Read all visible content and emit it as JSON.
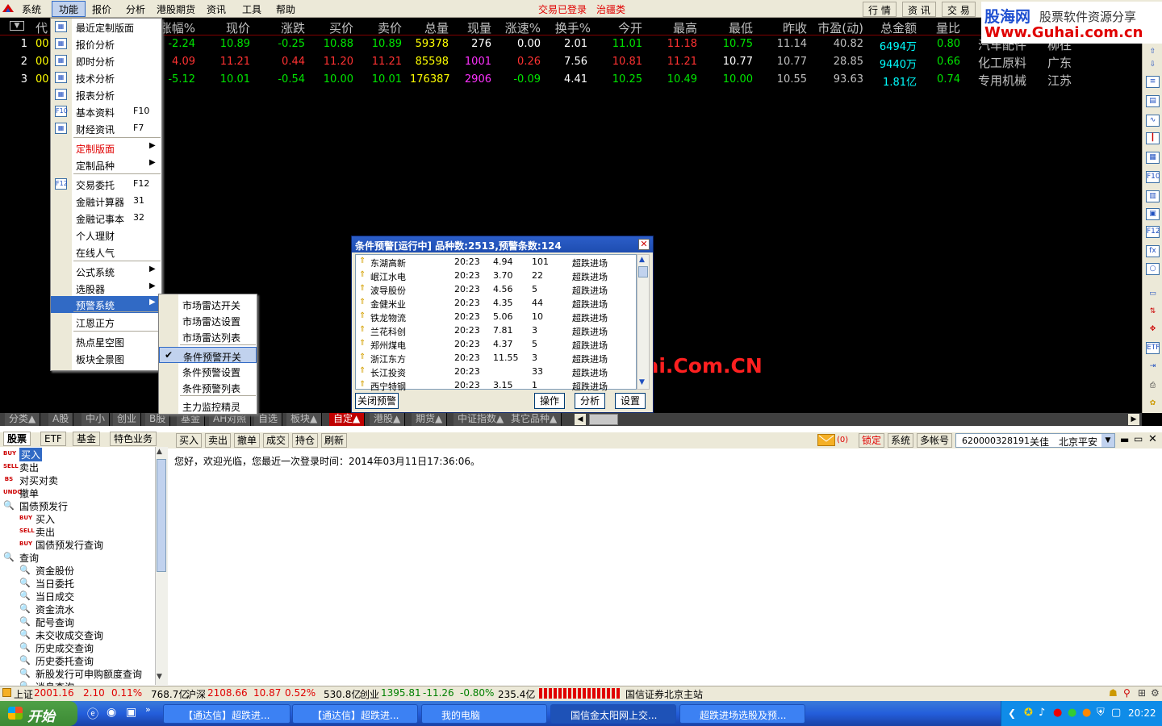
{
  "menubar": {
    "items": [
      "系统",
      "功能",
      "报价",
      "分析",
      "港股期货",
      "资讯",
      "工具",
      "帮助"
    ],
    "status1": "交易已登录",
    "status2": "治疆类",
    "tabs": [
      "行 情",
      "资 讯",
      "交 易"
    ]
  },
  "banner": {
    "brand": "股海网",
    "tagline": "股票软件资源分享",
    "url": "Www.Guhai.com.cn"
  },
  "grid": {
    "headers": [
      "代",
      "涨幅%",
      "现价",
      "涨跌",
      "买价",
      "卖价",
      "总量",
      "现量",
      "涨速%",
      "换手%",
      "今开",
      "最高",
      "最低",
      "昨收",
      "市盈(动)",
      "总金额",
      "量比"
    ],
    "rows": [
      {
        "idx": "1",
        "code": "00",
        "chg_pct": "-2.24",
        "price": "10.89",
        "chg": "-0.25",
        "bid": "10.88",
        "ask": "10.89",
        "vol": "59378",
        "cur_vol": "276",
        "speed": "0.00",
        "turnover": "2.01",
        "open": "11.01",
        "high": "11.18",
        "low": "10.75",
        "prev": "11.14",
        "pe": "40.82",
        "amount": "6494万",
        "vol_ratio": "0.80",
        "industry": "汽车配件",
        "region": "柳往"
      },
      {
        "idx": "2",
        "code": "00",
        "chg_pct": "4.09",
        "price": "11.21",
        "chg": "0.44",
        "bid": "11.20",
        "ask": "11.21",
        "vol": "85598",
        "cur_vol": "1001",
        "speed": "0.26",
        "turnover": "7.56",
        "open": "10.81",
        "high": "11.21",
        "low": "10.77",
        "prev": "10.77",
        "pe": "28.85",
        "amount": "9440万",
        "vol_ratio": "0.66",
        "industry": "化工原料",
        "region": "广东"
      },
      {
        "idx": "3",
        "code": "00",
        "chg_pct": "-5.12",
        "price": "10.01",
        "chg": "-0.54",
        "bid": "10.00",
        "ask": "10.01",
        "vol": "176387",
        "cur_vol": "2906",
        "speed": "-0.09",
        "turnover": "4.41",
        "open": "10.25",
        "high": "10.49",
        "low": "10.00",
        "prev": "10.55",
        "pe": "93.63",
        "amount": "1.81亿",
        "vol_ratio": "0.74",
        "industry": "专用机械",
        "region": "江苏"
      }
    ]
  },
  "dropdown": {
    "items": [
      {
        "label": "最近定制版面",
        "key": "",
        "icon": "layout-icon"
      },
      {
        "label": "报价分析",
        "key": "",
        "icon": "quote-icon"
      },
      {
        "label": "即时分析",
        "key": "",
        "icon": "realtime-chart-icon"
      },
      {
        "label": "技术分析",
        "key": "",
        "icon": "candlestick-icon"
      },
      {
        "label": "报表分析",
        "key": "",
        "icon": "report-icon"
      },
      {
        "label": "基本资料",
        "key": "F10",
        "icon": "f10-icon"
      },
      {
        "label": "财经资讯",
        "key": "F7",
        "icon": "news-icon"
      },
      {
        "label": "定制版面",
        "key": "",
        "icon": ""
      },
      {
        "label": "定制品种",
        "key": "",
        "icon": ""
      },
      {
        "label": "交易委托",
        "key": "F12",
        "icon": "f12-icon"
      },
      {
        "label": "金融计算器",
        "key": "31",
        "icon": ""
      },
      {
        "label": "金融记事本",
        "key": "32",
        "icon": ""
      },
      {
        "label": "个人理财",
        "key": "",
        "icon": ""
      },
      {
        "label": "在线人气",
        "key": "",
        "icon": ""
      },
      {
        "label": "公式系统",
        "key": "",
        "icon": ""
      },
      {
        "label": "选股器",
        "key": "",
        "icon": ""
      },
      {
        "label": "预警系统",
        "key": "",
        "icon": ""
      },
      {
        "label": "江恩正方",
        "key": "",
        "icon": ""
      },
      {
        "label": "热点星空图",
        "key": "",
        "icon": ""
      },
      {
        "label": "板块全景图",
        "key": "",
        "icon": ""
      }
    ]
  },
  "submenu": {
    "items": [
      "市场雷达开关",
      "市场雷达设置",
      "市场雷达列表",
      "条件预警开关",
      "条件预警设置",
      "条件预警列表",
      "主力监控精灵"
    ]
  },
  "alert": {
    "title": "条件预警[运行中] 品种数:2513,预警条数:124",
    "rows": [
      {
        "name": "东湖高新",
        "time": "20:23",
        "price": "4.94",
        "count": "101",
        "type": "超跌进场"
      },
      {
        "name": "岷江水电",
        "time": "20:23",
        "price": "3.70",
        "count": "22",
        "type": "超跌进场"
      },
      {
        "name": "波导股份",
        "time": "20:23",
        "price": "4.56",
        "count": "5",
        "type": "超跌进场"
      },
      {
        "name": "金健米业",
        "time": "20:23",
        "price": "4.35",
        "count": "44",
        "type": "超跌进场"
      },
      {
        "name": "铁龙物流",
        "time": "20:23",
        "price": "5.06",
        "count": "10",
        "type": "超跌进场"
      },
      {
        "name": "兰花科创",
        "time": "20:23",
        "price": "7.81",
        "count": "3",
        "type": "超跌进场"
      },
      {
        "name": "郑州煤电",
        "time": "20:23",
        "price": "4.37",
        "count": "5",
        "type": "超跌进场"
      },
      {
        "name": "浙江东方",
        "time": "20:23",
        "price": "11.55",
        "count": "3",
        "type": "超跌进场"
      },
      {
        "name": "长江投资",
        "time": "20:23",
        "price": "",
        "count": "33",
        "type": "超跌进场"
      },
      {
        "name": "西宁特钢",
        "time": "20:23",
        "price": "3.15",
        "count": "1",
        "type": "超跌进场"
      }
    ],
    "btn_close": "关闭预警",
    "btn_op": "操作",
    "btn_analyze": "分析",
    "btn_settings": "设置"
  },
  "watermark": "股海网提供 Www.Guhai.Com.CN",
  "cattabs": [
    "分类▲",
    "A股",
    "中小",
    "创业",
    "B股",
    "基金",
    "AH对照",
    "自选",
    "板块▲",
    "自定▲",
    "港股▲",
    "期货▲",
    "中证指数▲",
    "其它品种▲"
  ],
  "trade": {
    "left_tabs": [
      "股票",
      "ETF",
      "基金",
      "特色业务"
    ],
    "toolbar": [
      "买入",
      "卖出",
      "撤单",
      "成交",
      "持仓",
      "刷新"
    ],
    "mail_count": "(0)",
    "lock": "锁定",
    "system": "系统",
    "multi": "多帐号",
    "account": "620000328191",
    "account_name": "关佳",
    "branch": "北京平安",
    "welcome": "您好，欢迎光临，您最近一次登录时间：2014年03月11日17:36:06。",
    "tree": [
      {
        "label": "买入",
        "icon": "BUY",
        "level": 0
      },
      {
        "label": "卖出",
        "icon": "SELL",
        "level": 0
      },
      {
        "label": "对买对卖",
        "icon": "BS",
        "level": 0
      },
      {
        "label": "撤单",
        "icon": "UNDO",
        "level": 0
      },
      {
        "label": "国债预发行",
        "icon": "Q",
        "level": 0
      },
      {
        "label": "买入",
        "icon": "BUY",
        "level": 1
      },
      {
        "label": "卖出",
        "icon": "SELL",
        "level": 1
      },
      {
        "label": "国债预发行查询",
        "icon": "BUY",
        "level": 1
      },
      {
        "label": "查询",
        "icon": "Q",
        "level": 0
      },
      {
        "label": "资金股份",
        "icon": "Q",
        "level": 1
      },
      {
        "label": "当日委托",
        "icon": "Q",
        "level": 1
      },
      {
        "label": "当日成交",
        "icon": "Q",
        "level": 1
      },
      {
        "label": "资金流水",
        "icon": "Q",
        "level": 1
      },
      {
        "label": "配号查询",
        "icon": "Q",
        "level": 1
      },
      {
        "label": "未交收成交查询",
        "icon": "Q",
        "level": 1
      },
      {
        "label": "历史成交查询",
        "icon": "Q",
        "level": 1
      },
      {
        "label": "历史委托查询",
        "icon": "Q",
        "level": 1
      },
      {
        "label": "新股发行可申购额度查询",
        "icon": "Q",
        "level": 1
      },
      {
        "label": "逍息查询",
        "icon": "Q",
        "level": 1
      }
    ]
  },
  "statusbar": {
    "sh_label": "上证",
    "sh_val": "2001.16",
    "sh_chg": "2.10",
    "sh_pct": "0.11%",
    "sh_amt": "768.7亿",
    "hs_label": "沪深",
    "hs_val": "2108.66",
    "hs_chg": "10.87",
    "hs_pct": "0.52%",
    "hs_amt": "530.8亿",
    "cy_label": "创业",
    "cy_val": "1395.81",
    "cy_chg": "-11.26",
    "cy_pct": "-0.80%",
    "cy_amt": "235.4亿",
    "broker": "国信证券北京主站"
  },
  "taskbar": {
    "start": "开始",
    "tasks": [
      "【通达信】超跌进...",
      "【通达信】超跌进...",
      "我的电脑",
      "国信金太阳网上交...",
      "超跌进场选股及预..."
    ],
    "clock": "20:22"
  },
  "colors": {
    "up": "#ff3232",
    "down": "#00e600",
    "highlight": "#316ac5"
  }
}
